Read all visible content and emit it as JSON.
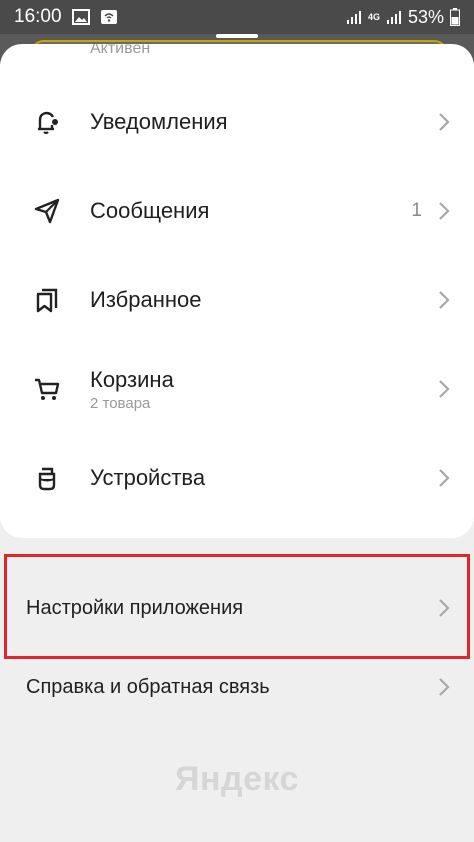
{
  "status_bar": {
    "time": "16:00",
    "network_label": "4G",
    "battery": "53%"
  },
  "header": {
    "active_text": "Активен"
  },
  "menu": [
    {
      "label": "Уведомления",
      "icon": "bell-icon"
    },
    {
      "label": "Сообщения",
      "icon": "send-icon",
      "count": "1"
    },
    {
      "label": "Избранное",
      "icon": "bookmarks-icon"
    },
    {
      "label": "Корзина",
      "sub": "2 товара",
      "icon": "cart-icon"
    },
    {
      "label": "Устройства",
      "icon": "device-icon"
    }
  ],
  "lower": {
    "settings": "Настройки приложения",
    "help": "Справка и обратная связь"
  },
  "brand": "Яндекс",
  "colors": {
    "highlight": "#e0252b",
    "accent_border": "#c8a400"
  }
}
